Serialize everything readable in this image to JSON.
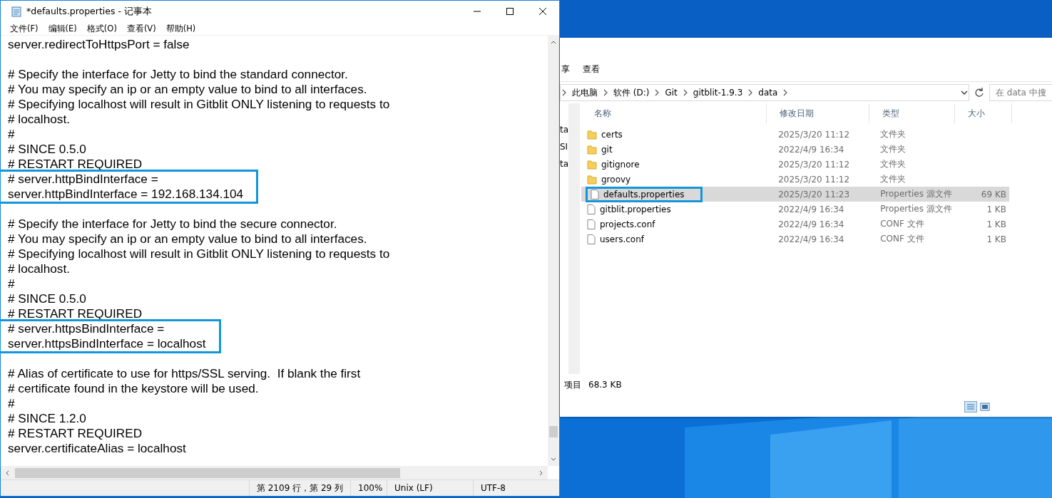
{
  "notepad": {
    "title": "*defaults.properties - 记事本",
    "menu": [
      "文件(F)",
      "编辑(E)",
      "格式(O)",
      "查看(V)",
      "帮助(H)"
    ],
    "paragraphs": [
      [
        {
          "boxed": false,
          "lines": [
            "server.redirectToHttpsPort = false"
          ]
        }
      ],
      [
        {
          "boxed": false,
          "lines": [
            "# Specify the interface for Jetty to bind the standard connector.",
            "# You may specify an ip or an empty value to bind to all interfaces.",
            "# Specifying localhost will result in Gitblit ONLY listening to requests to",
            "# localhost.",
            "#",
            "# SINCE 0.5.0",
            "# RESTART REQUIRED"
          ]
        },
        {
          "boxed": true,
          "lines": [
            "# server.httpBindInterface =",
            "server.httpBindInterface = 192.168.134.104"
          ]
        }
      ],
      [
        {
          "boxed": false,
          "lines": [
            "# Specify the interface for Jetty to bind the secure connector.",
            "# You may specify an ip or an empty value to bind to all interfaces.",
            "# Specifying localhost will result in Gitblit ONLY listening to requests to",
            "# localhost.",
            "#",
            "# SINCE 0.5.0",
            "# RESTART REQUIRED"
          ]
        },
        {
          "boxed": true,
          "lines": [
            "# server.httpsBindInterface =",
            "server.httpsBindInterface = localhost"
          ]
        }
      ],
      [
        {
          "boxed": false,
          "lines": [
            "# Alias of certificate to use for https/SSL serving.  If blank the first",
            "# certificate found in the keystore will be used.",
            "#",
            "# SINCE 1.2.0",
            "# RESTART REQUIRED",
            "server.certificateAlias = localhost"
          ]
        }
      ]
    ],
    "status": [
      "第 2109 行，第 29 列",
      "100%",
      "Unix (LF)",
      "UTF-8"
    ]
  },
  "explorer": {
    "nav_fragments": [
      "ta",
      "SI",
      "ta"
    ],
    "tabs": [
      "享",
      "查看"
    ],
    "breadcrumb": [
      "此电脑",
      "软件 (D:)",
      "Git",
      "gitblit-1.9.3",
      "data"
    ],
    "search": {
      "placeholder": "在 data 中搜"
    },
    "columns": [
      "名称",
      "修改日期",
      "类型",
      "大小"
    ],
    "files": [
      {
        "kind": "folder",
        "name": "certs",
        "modified": "2025/3/20 11:12",
        "type": "文件夹",
        "selected": false,
        "boxed": false
      },
      {
        "kind": "folder",
        "name": "git",
        "modified": "2022/4/9 16:34",
        "type": "文件夹",
        "selected": false,
        "boxed": false
      },
      {
        "kind": "folder",
        "name": "gitignore",
        "modified": "2025/3/20 11:12",
        "type": "文件夹",
        "selected": false,
        "boxed": false
      },
      {
        "kind": "folder",
        "name": "groovy",
        "modified": "2025/3/20 11:12",
        "type": "文件夹",
        "selected": false,
        "boxed": false
      },
      {
        "kind": "file",
        "name": "defaults.properties",
        "modified": "2025/3/20 11:23",
        "type": "Properties 源文件",
        "size": "69 KB",
        "selected": true,
        "boxed": true
      },
      {
        "kind": "file",
        "name": "gitblit.properties",
        "modified": "2022/4/9 16:34",
        "type": "Properties 源文件",
        "size": "1 KB",
        "selected": false,
        "boxed": false
      },
      {
        "kind": "file",
        "name": "projects.conf",
        "modified": "2022/4/9 16:34",
        "type": "CONF 文件",
        "size": "1 KB",
        "selected": false,
        "boxed": false
      },
      {
        "kind": "file",
        "name": "users.conf",
        "modified": "2022/4/9 16:34",
        "type": "CONF 文件",
        "size": "1 KB",
        "selected": false,
        "boxed": false
      }
    ],
    "status": [
      "项目",
      "68.3 KB"
    ]
  }
}
